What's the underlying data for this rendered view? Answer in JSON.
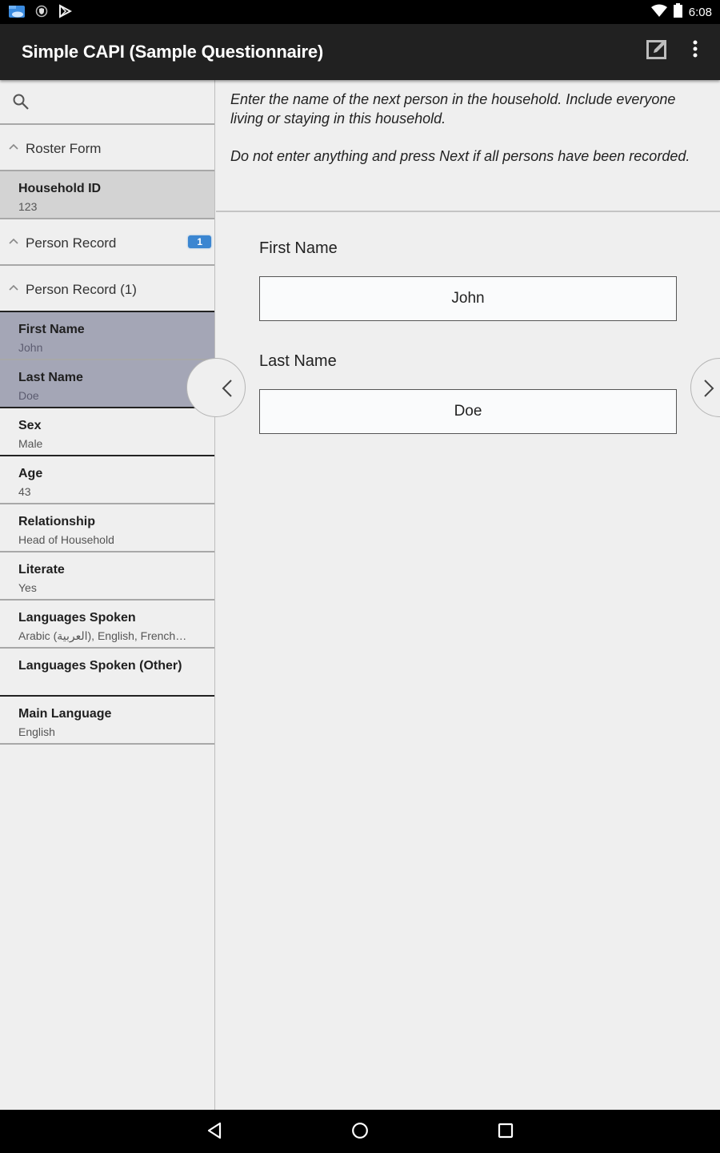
{
  "status_bar": {
    "notification_icons": [
      "file-manager-icon",
      "shield-icon",
      "play-store-icon"
    ],
    "time": "6:08",
    "system_icons": [
      "wifi-icon",
      "battery-icon"
    ]
  },
  "app_bar": {
    "title": "Simple CAPI (Sample Questionnaire)",
    "actions": [
      "edit-icon",
      "overflow-menu-icon"
    ]
  },
  "sidebar": {
    "search_icon": "search-icon",
    "groups": {
      "roster_form": {
        "label": "Roster Form"
      },
      "person_record": {
        "label": "Person Record",
        "badge": "1"
      },
      "person_record_1": {
        "label": "Person Record (1)"
      }
    },
    "household_id": {
      "name": "Household ID",
      "value": "123"
    },
    "fields": [
      {
        "name": "First Name",
        "value": "John"
      },
      {
        "name": "Last Name",
        "value": "Doe"
      },
      {
        "name": "Sex",
        "value": "Male"
      },
      {
        "name": "Age",
        "value": "43"
      },
      {
        "name": "Relationship",
        "value": "Head of Household"
      },
      {
        "name": "Literate",
        "value": "Yes"
      },
      {
        "name": "Languages Spoken",
        "value": "Arabic (العربية), English, French…"
      },
      {
        "name": "Languages Spoken (Other)",
        "value": ""
      },
      {
        "name": "Main Language",
        "value": "English"
      }
    ]
  },
  "main": {
    "question_text": [
      "Enter the name of the next person in the household. Include everyone living or staying in this household.",
      "Do not enter anything and press Next if all persons have been recorded."
    ],
    "inputs": [
      {
        "label": "First Name",
        "value": "John"
      },
      {
        "label": "Last Name",
        "value": "Doe"
      }
    ],
    "prev_icon": "chevron-left-icon",
    "next_icon": "chevron-right-icon"
  },
  "nav_bar": {
    "buttons": [
      "back-icon",
      "home-icon",
      "recents-icon"
    ]
  },
  "colors": {
    "app_bar": "#212121",
    "badge": "#3b86d1",
    "current_field": "#a4a6b6",
    "id_field": "#d3d3d3",
    "background": "#efefef"
  }
}
